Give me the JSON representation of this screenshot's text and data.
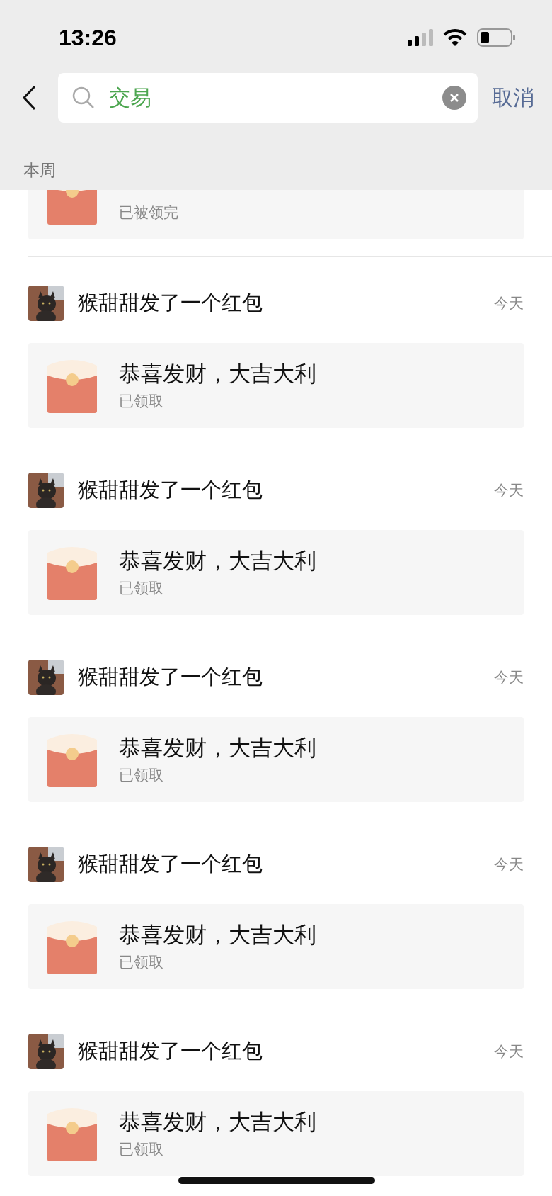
{
  "status_bar": {
    "time": "13:26"
  },
  "search": {
    "value": "交易"
  },
  "cancel": "取消",
  "section_label": "本周",
  "items": [
    {
      "kind": "partial",
      "status": "已被领完"
    },
    {
      "kind": "full",
      "sender_line": "猴甜甜发了一个红包",
      "time": "今天",
      "greeting": "恭喜发财，大吉大利",
      "status": "已领取"
    },
    {
      "kind": "full",
      "sender_line": "猴甜甜发了一个红包",
      "time": "今天",
      "greeting": "恭喜发财，大吉大利",
      "status": "已领取"
    },
    {
      "kind": "full",
      "sender_line": "猴甜甜发了一个红包",
      "time": "今天",
      "greeting": "恭喜发财，大吉大利",
      "status": "已领取"
    },
    {
      "kind": "full",
      "sender_line": "猴甜甜发了一个红包",
      "time": "今天",
      "greeting": "恭喜发财，大吉大利",
      "status": "已领取"
    },
    {
      "kind": "full",
      "sender_line": "猴甜甜发了一个红包",
      "time": "今天",
      "greeting": "恭喜发财，大吉大利",
      "status": "已领取"
    }
  ]
}
